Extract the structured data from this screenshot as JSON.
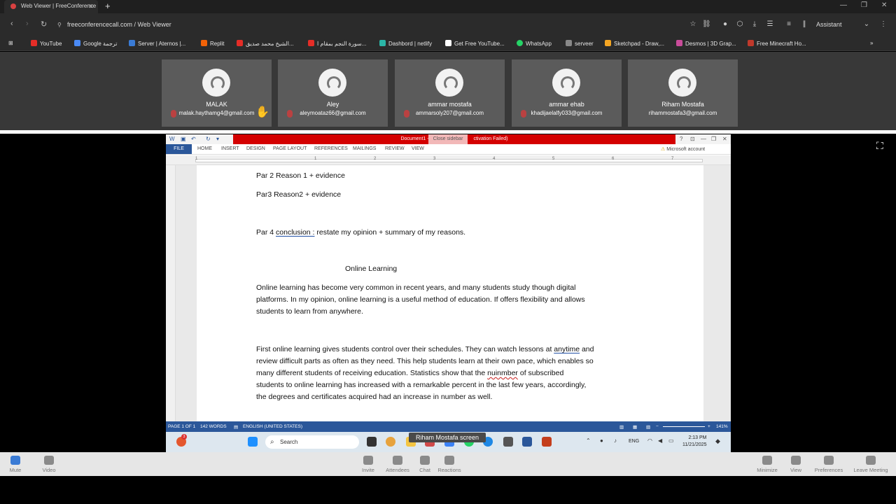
{
  "browser": {
    "tab_title": "Web Viewer | FreeConference",
    "url": "freeconferencecall.com / Web Viewer",
    "assistant_label": "Assistant",
    "bookmarks": [
      {
        "label": "YouTube",
        "color": "#e52d27"
      },
      {
        "label": "Google ترجمة",
        "color": "#4a8af4"
      },
      {
        "label": "Server | Aternos |...",
        "color": "#3a7bd5"
      },
      {
        "label": "Replit",
        "color": "#f26207"
      },
      {
        "label": "الشيخ محمد صديق...",
        "color": "#e52d27"
      },
      {
        "label": "سورة النجم بمقام ا...",
        "color": "#e52d27"
      },
      {
        "label": "Dashbord | netlify",
        "color": "#2bb5a6"
      },
      {
        "label": "Get Free YouTube...",
        "color": "#ffffff"
      },
      {
        "label": "WhatsApp",
        "color": "#25d366"
      },
      {
        "label": "serveer",
        "color": "#888888"
      },
      {
        "label": "Sketchpad - Draw,...",
        "color": "#f5a623"
      },
      {
        "label": "Desmos | 3D Grap...",
        "color": "#c94c9a"
      },
      {
        "label": "Free Minecraft Ho...",
        "color": "#c0392b"
      }
    ]
  },
  "participants": [
    {
      "name": "MALAK",
      "email": "malak.haythamg4@gmail.com"
    },
    {
      "name": "Aley",
      "email": "aleymoataz66@gmail.com"
    },
    {
      "name": "ammar mostafa",
      "email": "ammarsoly207@gmail.com"
    },
    {
      "name": "ammar ehab",
      "email": "khadijaelalfy033@gmail.com"
    },
    {
      "name": "Riham Mostafa",
      "email": "rihammostafa3@gmail.com"
    }
  ],
  "word": {
    "title": "Document1 -",
    "title_tail": "ctivation Failed)",
    "close_sidebar": "Close sidebar",
    "tabs": [
      "FILE",
      "HOME",
      "INSERT",
      "DESIGN",
      "PAGE LAYOUT",
      "REFERENCES",
      "MAILINGS",
      "REVIEW",
      "VIEW"
    ],
    "account": "Microsoft account",
    "ruler_numbers": [
      "1",
      "1",
      "2",
      "3",
      "4",
      "5",
      "6",
      "7"
    ],
    "doc": {
      "line1": "Par 2 Reason 1 + evidence",
      "line2": "Par3 Reason2 + evidence",
      "line3_pre": "Par 4 ",
      "line3_link": "conclusion :",
      "line3_post": " restate my opinion + summary of my reasons.",
      "heading": "Online Learning",
      "p1": [
        "Online learning has become very common in recent years, and many students study though digital",
        "platforms. In my opinion, online learning is a useful method of education. If offers flexibility and allows",
        "students to learn from anywhere."
      ],
      "p2_l1_pre": "First online learning gives students control over their schedules. They can watch lessons at ",
      "p2_l1_err": "anytime",
      "p2_l1_post": " and",
      "p2_l2": "review difficult parts as often as they need. This help students learn at their own pace, which enables so",
      "p2_l3_pre": "many different students of receiving education. Statistics show that the ",
      "p2_l3_err": "nuinmber",
      "p2_l3_post": " of subscribed",
      "p2_l4": "students to online learning has  increased with a remarkable percent in the last few years, accordingly,",
      "p2_l5": "the degrees and certificates acquired had an increase in number as well."
    },
    "status": {
      "page": "PAGE 1 OF 1",
      "words": "142 WORDS",
      "lang": "ENGLISH (UNITED STATES)",
      "zoom": "141%"
    }
  },
  "taskbar": {
    "search": "Search",
    "lang": "ENG",
    "time": "2:13 PM",
    "date": "11/21/2025",
    "notif_count": "3"
  },
  "screen_share_label": "Riham Mostafa screen",
  "controls": {
    "mute": "Mute",
    "video": "Video",
    "invite": "Invite",
    "attendees": "Attendees",
    "chat": "Chat",
    "reactions": "Reactions",
    "minimize": "Minimize",
    "view": "View",
    "preferences": "Preferences",
    "leave": "Leave Meeting"
  }
}
